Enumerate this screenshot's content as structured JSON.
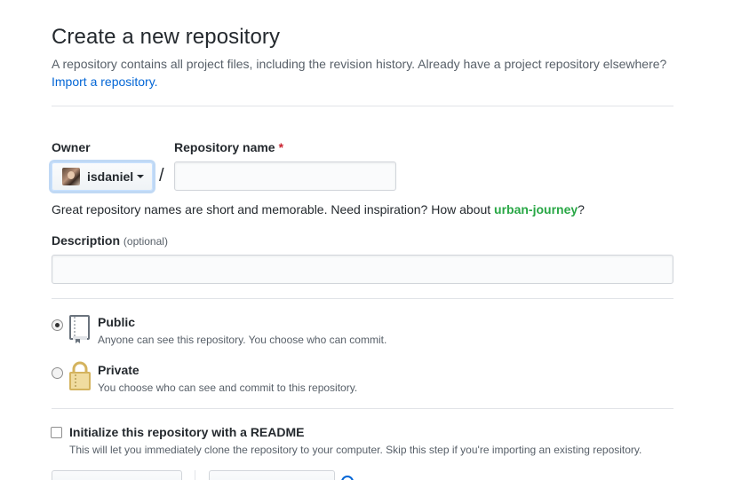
{
  "header": {
    "title": "Create a new repository",
    "subtitle": "A repository contains all project files, including the revision history. Already have a project repository elsewhere?",
    "import_link": "Import a repository."
  },
  "owner": {
    "label": "Owner",
    "value": "isdaniel"
  },
  "repo_name": {
    "label": "Repository name",
    "required_mark": "*",
    "value": "",
    "placeholder": ""
  },
  "separator": "/",
  "hint": {
    "prefix": "Great repository names are short and memorable. Need inspiration? How about ",
    "suggestion": "urban-journey",
    "suffix": "?"
  },
  "description": {
    "label": "Description",
    "optional": "(optional)",
    "value": "",
    "placeholder": ""
  },
  "visibility": {
    "selected": "public",
    "options": [
      {
        "id": "public",
        "title": "Public",
        "description": "Anyone can see this repository. You choose who can commit.",
        "icon": "book-icon"
      },
      {
        "id": "private",
        "title": "Private",
        "description": "You choose who can see and commit to this repository.",
        "icon": "lock-icon"
      }
    ]
  },
  "readme": {
    "checked": false,
    "label": "Initialize this repository with a README",
    "description": "This will let you immediately clone the repository to your computer. Skip this step if you're importing an existing repository."
  },
  "colors": {
    "link": "#0366d6",
    "suggestion": "#28a745",
    "required": "#cb2431",
    "lock": "#d4b35e"
  }
}
